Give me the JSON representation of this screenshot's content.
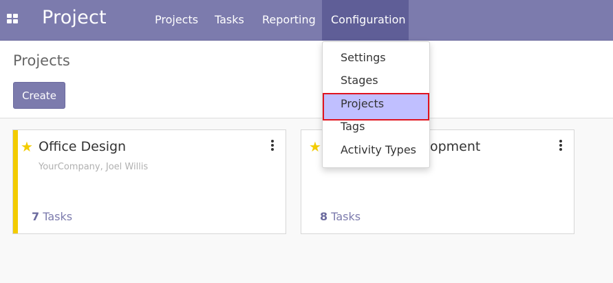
{
  "app": {
    "title": "Project"
  },
  "nav": {
    "menus": [
      "Projects",
      "Tasks",
      "Reporting",
      "Configuration"
    ],
    "active": "Configuration"
  },
  "breadcrumb": "Projects",
  "toolbar": {
    "create_label": "Create"
  },
  "dropdown": {
    "items": [
      "Settings",
      "Stages",
      "Projects",
      "Tags",
      "Activity Types"
    ],
    "highlighted": "Projects"
  },
  "cards": [
    {
      "name": "Office Design",
      "subtitle": "YourCompany, Joel Willis",
      "task_count": "7",
      "task_label": "Tasks",
      "favorite": true,
      "color": "#f3cc00"
    },
    {
      "name": "Research & Development",
      "visible_name": "elopment",
      "subtitle": "",
      "task_count": "8",
      "task_label": "Tasks",
      "favorite": true
    }
  ],
  "colors": {
    "navbar": "#7c7bad",
    "active_menu": "#5f5e97",
    "highlight": "#c0bfff",
    "highlight_border": "#e0131e",
    "star": "#f3cc00"
  }
}
